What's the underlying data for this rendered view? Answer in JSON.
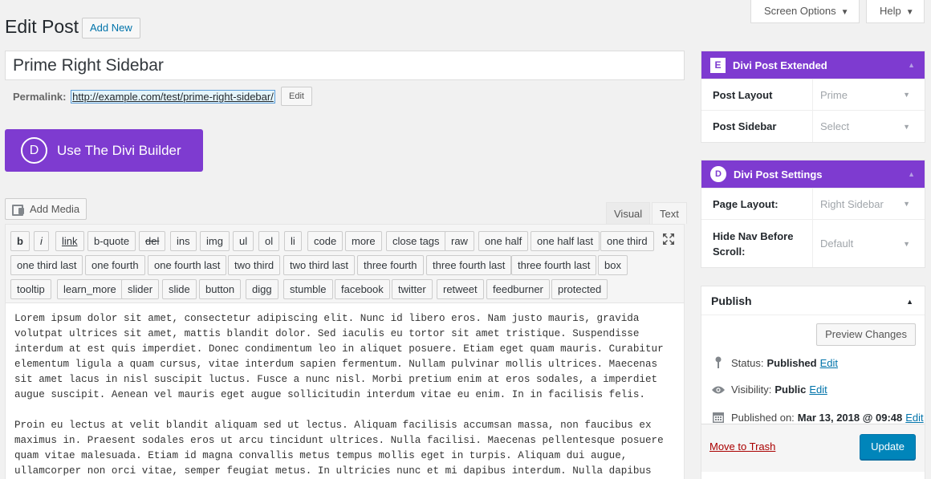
{
  "header": {
    "title": "Edit Post",
    "add_new": "Add New",
    "screen_options": "Screen Options",
    "help": "Help"
  },
  "post": {
    "title": "Prime Right Sidebar",
    "permalink_label": "Permalink:",
    "permalink_base": "http://example.com/test/",
    "permalink_slug": "prime-right-sidebar/",
    "permalink_edit": "Edit"
  },
  "divi_button": {
    "logo_letter": "D",
    "label": "Use The Divi Builder"
  },
  "editor": {
    "add_media": "Add Media",
    "tab_visual": "Visual",
    "tab_text": "Text",
    "quicktags": [
      "b",
      "i",
      "link",
      "b-quote",
      "del",
      "ins",
      "img",
      "ul",
      "ol",
      "li",
      "code",
      "more",
      "close tags",
      "raw",
      "one half",
      "one half last",
      "one third",
      "one third last",
      "one fourth",
      "one fourth last",
      "two third",
      "two third last",
      "three fourth",
      "three fourth last",
      "three fourth last",
      "box",
      "tooltip",
      "learn_more",
      "slider",
      "slide",
      "button",
      "digg",
      "stumble",
      "facebook",
      "twitter",
      "retweet",
      "feedburner",
      "protected"
    ],
    "content": "Lorem ipsum dolor sit amet, consectetur adipiscing elit. Nunc id libero eros. Nam justo mauris, gravida volutpat ultrices sit amet, mattis blandit dolor. Sed iaculis eu tortor sit amet tristique. Suspendisse interdum at est quis imperdiet. Donec condimentum leo in aliquet posuere. Etiam eget quam mauris. Curabitur elementum ligula a quam cursus, vitae interdum sapien fermentum. Nullam pulvinar mollis ultrices. Maecenas sit amet lacus in nisl suscipit luctus. Fusce a nunc nisl. Morbi pretium enim at eros sodales, a imperdiet augue suscipit. Aenean vel mauris eget augue sollicitudin interdum vitae eu enim. In in facilisis felis.\n\nProin eu lectus at velit blandit aliquam sed ut lectus. Aliquam facilisis accumsan massa, non faucibus ex maximus in. Praesent sodales eros ut arcu tincidunt ultrices. Nulla facilisi. Maecenas pellentesque posuere quam vitae malesuada. Etiam id magna convallis metus tempus mollis eget in turpis. Aliquam dui augue, ullamcorper non orci vitae, semper feugiat metus. In ultricies nunc et mi dapibus interdum. Nulla dapibus sed ligula non congue. Donec"
  },
  "post_extended": {
    "badge": "E",
    "title": "Divi Post Extended",
    "rows": [
      {
        "label": "Post Layout",
        "value": "Prime"
      },
      {
        "label": "Post Sidebar",
        "value": "Select"
      }
    ]
  },
  "post_settings": {
    "badge": "D",
    "title": "Divi Post Settings",
    "rows": [
      {
        "label": "Page Layout:",
        "value": "Right Sidebar"
      },
      {
        "label": "Hide Nav Before Scroll:",
        "value": "Default"
      }
    ]
  },
  "publish": {
    "title": "Publish",
    "preview": "Preview Changes",
    "status_label": "Status:",
    "status_value": "Published",
    "visibility_label": "Visibility:",
    "visibility_value": "Public",
    "published_label": "Published on:",
    "published_value": "Mar 13, 2018 @ 09:48",
    "edit": "Edit",
    "trash": "Move to Trash",
    "update": "Update"
  },
  "icons": [
    "add-media-icon",
    "fullscreen-icon",
    "pin-icon",
    "eye-icon",
    "calendar-icon",
    "caret-up-icon",
    "dropdown-arrow-icon"
  ],
  "colors": {
    "divi_purple": "#7e3bd0",
    "wp_blue": "#0085ba",
    "link_blue": "#0073aa",
    "trash_red": "#a00"
  }
}
